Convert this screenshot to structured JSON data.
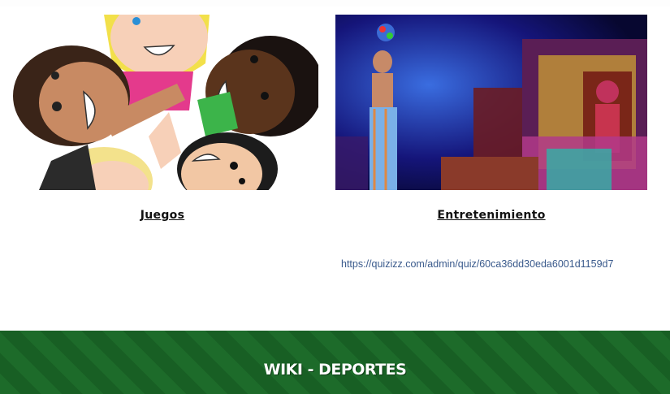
{
  "cards": [
    {
      "title": "Juegos",
      "image": "kids-playing-illustration"
    },
    {
      "title": "Entretenimiento",
      "image": "circus-stage-photo"
    }
  ],
  "link": {
    "text": "https://quizizz.com/admin/quiz/60ca36dd30eda6001d1159d7"
  },
  "footer": {
    "title": "WIKI - DEPORTES"
  },
  "colors": {
    "footer_green": "#1d6b2a",
    "link_blue": "#3a5a8c"
  }
}
